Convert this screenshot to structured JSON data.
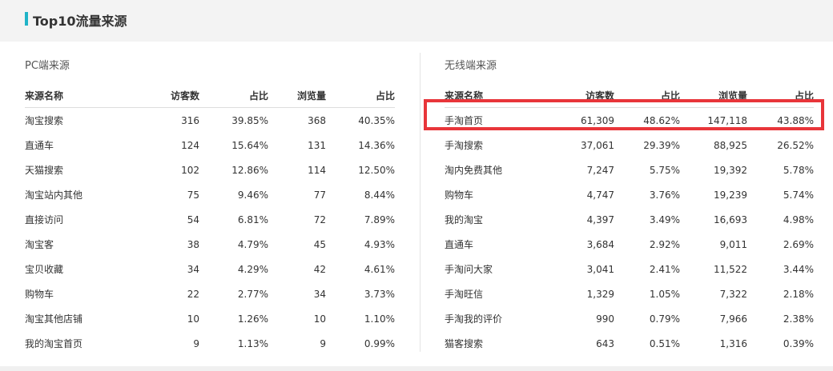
{
  "header": {
    "title": "Top10流量来源"
  },
  "pc": {
    "title": "PC端来源",
    "columns": [
      "来源名称",
      "访客数",
      "占比",
      "浏览量",
      "占比"
    ],
    "rows": [
      [
        "淘宝搜索",
        "316",
        "39.85%",
        "368",
        "40.35%"
      ],
      [
        "直通车",
        "124",
        "15.64%",
        "131",
        "14.36%"
      ],
      [
        "天猫搜索",
        "102",
        "12.86%",
        "114",
        "12.50%"
      ],
      [
        "淘宝站内其他",
        "75",
        "9.46%",
        "77",
        "8.44%"
      ],
      [
        "直接访问",
        "54",
        "6.81%",
        "72",
        "7.89%"
      ],
      [
        "淘宝客",
        "38",
        "4.79%",
        "45",
        "4.93%"
      ],
      [
        "宝贝收藏",
        "34",
        "4.29%",
        "42",
        "4.61%"
      ],
      [
        "购物车",
        "22",
        "2.77%",
        "34",
        "3.73%"
      ],
      [
        "淘宝其他店铺",
        "10",
        "1.26%",
        "10",
        "1.10%"
      ],
      [
        "我的淘宝首页",
        "9",
        "1.13%",
        "9",
        "0.99%"
      ]
    ]
  },
  "mobile": {
    "title": "无线端来源",
    "columns": [
      "来源名称",
      "访客数",
      "占比",
      "浏览量",
      "占比"
    ],
    "rows": [
      [
        "手淘首页",
        "61,309",
        "48.62%",
        "147,118",
        "43.88%"
      ],
      [
        "手淘搜索",
        "37,061",
        "29.39%",
        "88,925",
        "26.52%"
      ],
      [
        "淘内免费其他",
        "7,247",
        "5.75%",
        "19,392",
        "5.78%"
      ],
      [
        "购物车",
        "4,747",
        "3.76%",
        "19,239",
        "5.74%"
      ],
      [
        "我的淘宝",
        "4,397",
        "3.49%",
        "16,693",
        "4.98%"
      ],
      [
        "直通车",
        "3,684",
        "2.92%",
        "9,011",
        "2.69%"
      ],
      [
        "手淘问大家",
        "3,041",
        "2.41%",
        "11,522",
        "3.44%"
      ],
      [
        "手淘旺信",
        "1,329",
        "1.05%",
        "7,322",
        "2.18%"
      ],
      [
        "手淘我的评价",
        "990",
        "0.79%",
        "7,966",
        "2.38%"
      ],
      [
        "猫客搜索",
        "643",
        "0.51%",
        "1,316",
        "0.39%"
      ]
    ]
  },
  "colors": {
    "accent": "#1fb3c7",
    "highlight": "#e8353a"
  }
}
